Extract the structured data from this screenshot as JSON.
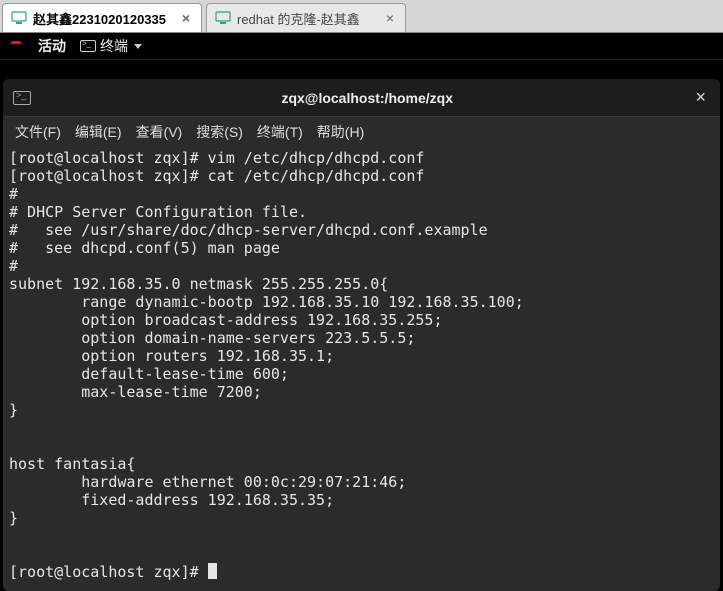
{
  "tabs": {
    "active": {
      "label": "赵其鑫2231020120335"
    },
    "inactive": {
      "label": "redhat 的克隆-赵其鑫"
    }
  },
  "gnome": {
    "activities": "活动",
    "terminal_launcher": "终端"
  },
  "terminal": {
    "title": "zqx@localhost:/home/zqx",
    "menu": {
      "file": "文件(F)",
      "edit": "编辑(E)",
      "view": "查看(V)",
      "search": "搜索(S)",
      "terminal": "终端(T)",
      "help": "帮助(H)"
    },
    "lines": [
      "[root@localhost zqx]# vim /etc/dhcp/dhcpd.conf",
      "[root@localhost zqx]# cat /etc/dhcp/dhcpd.conf",
      "#",
      "# DHCP Server Configuration file.",
      "#   see /usr/share/doc/dhcp-server/dhcpd.conf.example",
      "#   see dhcpd.conf(5) man page",
      "#",
      "subnet 192.168.35.0 netmask 255.255.255.0{",
      "        range dynamic-bootp 192.168.35.10 192.168.35.100;",
      "        option broadcast-address 192.168.35.255;",
      "        option domain-name-servers 223.5.5.5;",
      "        option routers 192.168.35.1;",
      "        default-lease-time 600;",
      "        max-lease-time 7200;",
      "}",
      "",
      "",
      "host fantasia{",
      "        hardware ethernet 00:0c:29:07:21:46;",
      "        fixed-address 192.168.35.35;",
      "}",
      "",
      "",
      "[root@localhost zqx]# "
    ]
  }
}
